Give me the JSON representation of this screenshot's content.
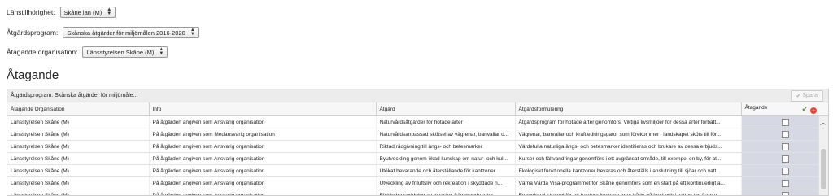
{
  "filters": {
    "lanstillhorighet": {
      "label": "Länstillhörighet:",
      "value": "Skåne län (M)"
    },
    "atgardsprogram": {
      "label": "Åtgärdsprogram:",
      "value": "Skånska åtgärder för miljömålen 2016-2020"
    },
    "atagande_org": {
      "label": "Åtagande organisation:",
      "value": "Länsstyrelsen Skåne (M)"
    }
  },
  "heading": "Åtagande",
  "panel": {
    "program_label": "Åtgärdsprogram: Skånska åtgärder för miljömåle...",
    "save_label": "Spara"
  },
  "table": {
    "headers": [
      "Åtagande Organisation",
      "Info",
      "Åtgärd",
      "Åtgärdsformulering",
      "Åtagande"
    ],
    "rows": [
      [
        "Länsstyrelsen Skåne (M)",
        "På åtgärden angiven som Ansvarig organisation",
        "Naturvårdsåtgärder för hotade arter",
        "Åtgärdsprogram för hotade arter genomförs. Viktiga livsmiljöer för dessa arter förbätt..."
      ],
      [
        "Länsstyrelsen Skåne (M)",
        "På åtgärden angiven som Medansvarig organisation",
        "Naturvårdsanpassad skötsel av vägrenar, banvallar o...",
        "Vägrenar, banvallar och kraftledningsgator som förekommer i landskapet sköts till för..."
      ],
      [
        "Länsstyrelsen Skåne (M)",
        "På åtgärden angiven som Ansvarig organisation",
        "Riktad rådgivning till ängs- och betesmarker",
        "Värdefulla naturliga ängs- och betesmarker identifieras och brukare av dessa erbjuds..."
      ],
      [
        "Länsstyrelsen Skåne (M)",
        "På åtgärden angiven som Ansvarig organisation",
        "Byutveckling genom ökad kunskap om natur- och kul...",
        "Kurser och fältvandringar genomförs i ett avgränsat område, till exempel en by, för at..."
      ],
      [
        "Länsstyrelsen Skåne (M)",
        "På åtgärden angiven som Ansvarig organisation",
        "Utökat bevarande och återställande för kantzoner",
        "Ekologiskt funktionella kantzoner bevaras och återställs i anslutning till sjöar och vatt..."
      ],
      [
        "Länsstyrelsen Skåne (M)",
        "På åtgärden angiven som Ansvarig organisation",
        "Utveckling av friluftsliv och rekreation i skyddade n...",
        "Värna Vårda Visa-programmet för Skåne genomförs som en start på ett kontinuerligt a..."
      ],
      [
        "Länsstyrelsen Skåne (M)",
        "På åtgärden angiven som Ansvarig organisation",
        "Förhindra spridning av invasiva främmande arter",
        "En regional strategi för att hantera invasiva arter både på land och i vatten tas fram o..."
      ]
    ]
  },
  "icons": {
    "ok": "checkmark-icon",
    "cancel": "cancel-icon",
    "scroll_up": "chevron-up-icon"
  }
}
